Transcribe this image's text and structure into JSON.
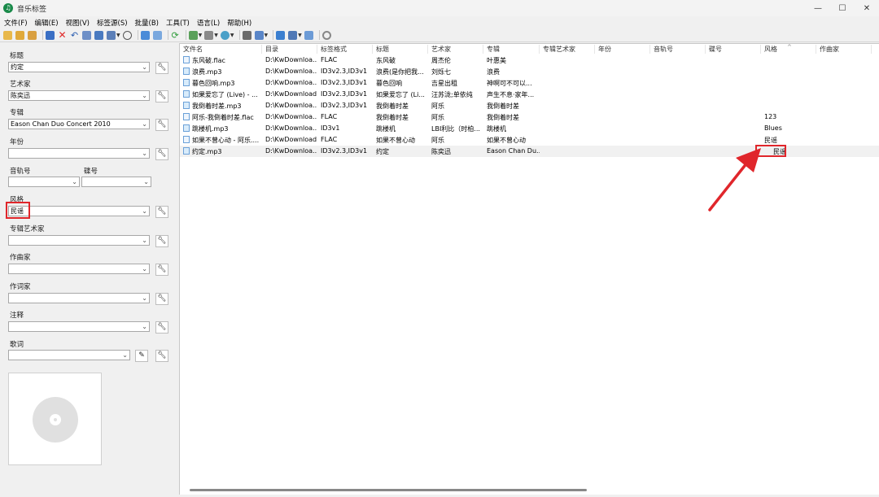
{
  "window": {
    "title": "音乐标签",
    "app_icon_glyph": "♫",
    "minimize": "—",
    "maximize": "☐",
    "close": "✕"
  },
  "menu": [
    "文件(F)",
    "编辑(E)",
    "视图(V)",
    "标签源(S)",
    "批量(B)",
    "工具(T)",
    "语言(L)",
    "帮助(H)"
  ],
  "toolbar_icons": [
    "open-folder-icon",
    "add-folder-icon",
    "add-files-icon",
    "save-icon",
    "delete-icon",
    "undo-icon",
    "book-icon",
    "wand-icon",
    "tag-source-icon",
    "clock-icon",
    "panel-left-icon",
    "panel-grid-icon",
    "refresh-icon",
    "image-icon",
    "list-icon",
    "color-icon",
    "tool-icon",
    "copy-icon",
    "convert-icon",
    "rename-icon",
    "screen-icon",
    "settings-icon"
  ],
  "fields": {
    "title": {
      "label": "标题",
      "value": "约定"
    },
    "artist": {
      "label": "艺术家",
      "value": "陈奕迅"
    },
    "album": {
      "label": "专辑",
      "value": "Eason Chan Duo Concert 2010"
    },
    "year": {
      "label": "年份",
      "value": ""
    },
    "track": {
      "label": "音轨号",
      "value": ""
    },
    "disc": {
      "label": "碟号",
      "value": ""
    },
    "genre": {
      "label": "风格",
      "value": "民谣"
    },
    "album_artist": {
      "label": "专辑艺术家",
      "value": ""
    },
    "composer": {
      "label": "作曲家",
      "value": ""
    },
    "lyricist": {
      "label": "作词家",
      "value": ""
    },
    "comment": {
      "label": "注释",
      "value": ""
    },
    "lyrics": {
      "label": "歌词",
      "value": ""
    }
  },
  "columns": [
    "文件名",
    "目录",
    "标签格式",
    "标题",
    "艺术家",
    "专辑",
    "专辑艺术家",
    "年份",
    "音轨号",
    "碟号",
    "风格",
    "作曲家"
  ],
  "rows": [
    {
      "filename": "东风破.flac",
      "dir": "D:\\KwDownloa...",
      "format": "FLAC",
      "title": "东风破",
      "artist": "周杰伦",
      "album": "叶惠美",
      "genre": ""
    },
    {
      "filename": "浪费.mp3",
      "dir": "D:\\KwDownloa...",
      "format": "ID3v2.3,ID3v1",
      "title": "浪费(是你把我...",
      "artist": "刘烁七",
      "album": "浪费",
      "genre": ""
    },
    {
      "filename": "暮色回响.mp3",
      "dir": "D:\\KwDownloa...",
      "format": "ID3v2.3,ID3v1",
      "title": "暮色回响",
      "artist": "吉星出租",
      "album": "神啊可不可以...",
      "genre": ""
    },
    {
      "filename": "如果爱忘了 (Live) - ...",
      "dir": "D:\\KwDownload",
      "format": "ID3v2.3,ID3v1",
      "title": "如果爱忘了 (Li...",
      "artist": "汪苏泷;单依纯",
      "album": "声生不息·家年...",
      "genre": ""
    },
    {
      "filename": "我倒着时差.mp3",
      "dir": "D:\\KwDownloa...",
      "format": "ID3v2.3,ID3v1",
      "title": "我倒着时差",
      "artist": "阿乐",
      "album": "我倒着时差",
      "genre": ""
    },
    {
      "filename": "阿乐-我倒着时差.flac",
      "dir": "D:\\KwDownloa...",
      "format": "FLAC",
      "title": "我倒着时差",
      "artist": "阿乐",
      "album": "我倒着时差",
      "genre": "123"
    },
    {
      "filename": "跳楼机.mp3",
      "dir": "D:\\KwDownloa...",
      "format": "ID3v1",
      "title": "跳楼机",
      "artist": "LBI利比（时柏...",
      "album": "跳楼机",
      "genre": "Blues"
    },
    {
      "filename": "如果不曾心动 - 阿乐....",
      "dir": "D:\\KwDownload",
      "format": "FLAC",
      "title": "如果不曾心动",
      "artist": "阿乐",
      "album": "如果不曾心动",
      "genre": "民谣"
    },
    {
      "filename": "约定.mp3",
      "dir": "D:\\KwDownloa...",
      "format": "ID3v2.3,ID3v1",
      "title": "约定",
      "artist": "陈奕迅",
      "album": "Eason Chan Du...",
      "genre": "民谣"
    }
  ],
  "colors": {
    "highlight": "#e0262b",
    "selected_row": "#f1f1f1",
    "accent": "#1a8a4a"
  }
}
